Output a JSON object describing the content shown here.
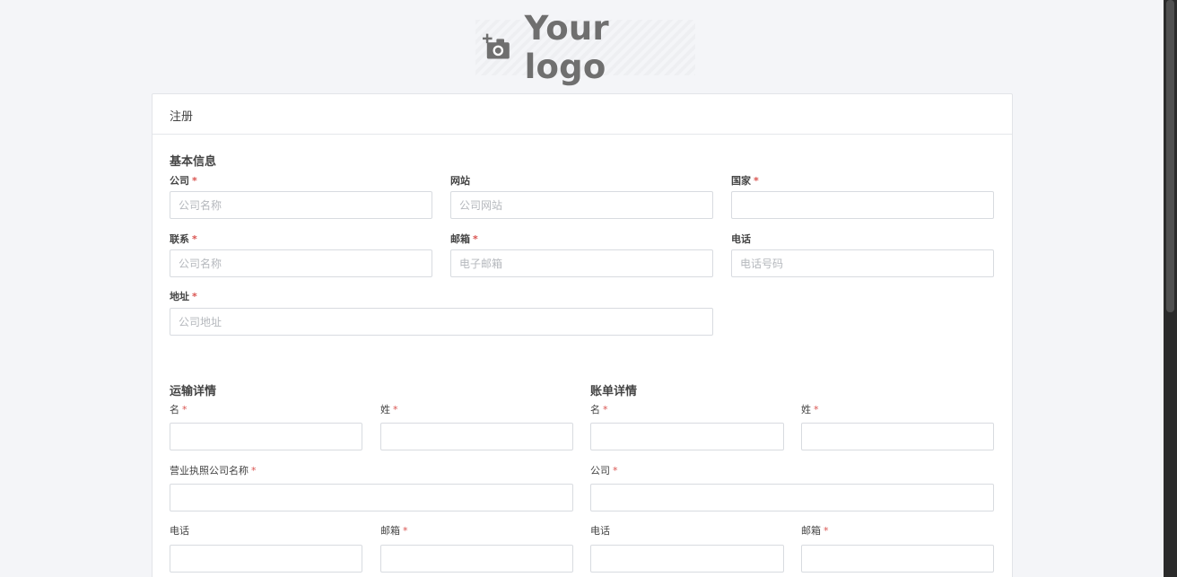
{
  "logo": {
    "text": "Your logo",
    "icon": "camera-plus-icon"
  },
  "card": {
    "title": "注册"
  },
  "basic": {
    "title": "基本信息",
    "company_label": "公司",
    "company_placeholder": "公司名称",
    "website_label": "网站",
    "website_placeholder": "公司网站",
    "country_label": "国家",
    "country_placeholder": "",
    "contact_label": "联系",
    "contact_placeholder": "公司名称",
    "email_label": "邮箱",
    "email_placeholder": "电子邮箱",
    "phone_label": "电话",
    "phone_placeholder": "电话号码",
    "address_label": "地址",
    "address_placeholder": "公司地址"
  },
  "shipping": {
    "title": "运输详情",
    "first_name_label": "名",
    "last_name_label": "姓",
    "license_company_label": "营业执照公司名称",
    "phone_label": "电话",
    "email_label": "邮箱"
  },
  "billing": {
    "title": "账单详情",
    "first_name_label": "名",
    "last_name_label": "姓",
    "company_label": "公司",
    "phone_label": "电话",
    "email_label": "邮箱"
  },
  "required_mark": "*",
  "colors": {
    "background": "#f4f5f8",
    "required": "#d9534f",
    "border": "#d8dbe0"
  }
}
